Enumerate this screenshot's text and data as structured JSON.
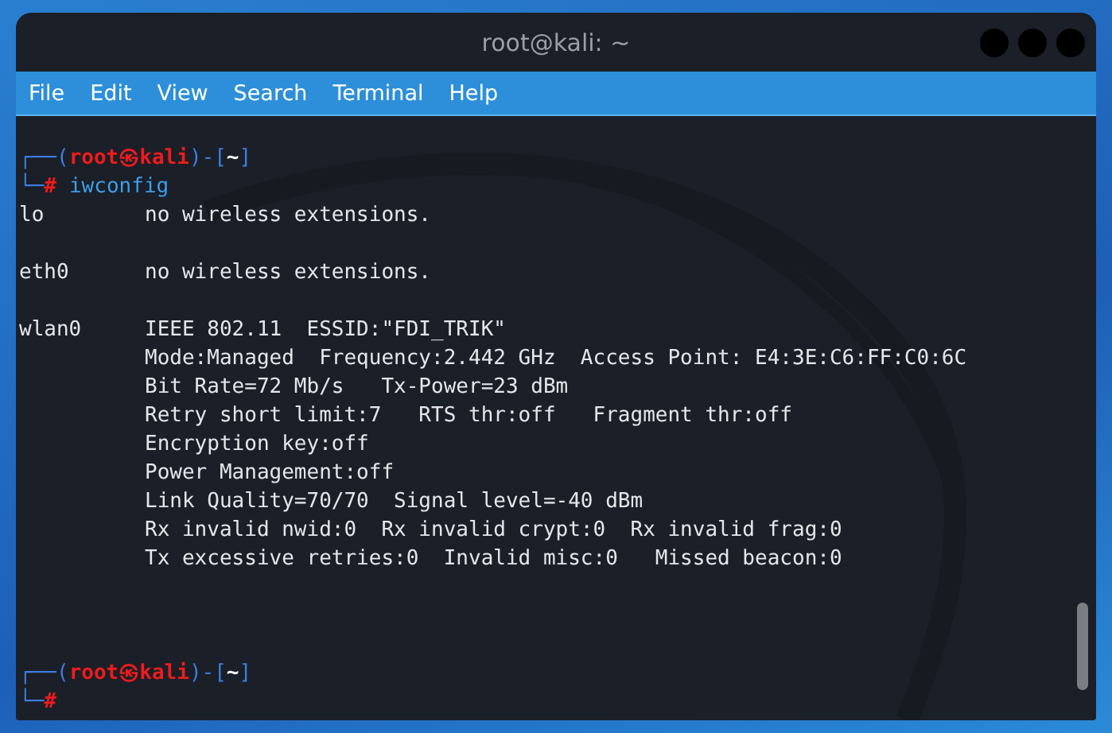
{
  "window": {
    "title": "root@kali: ~"
  },
  "menu": [
    "File",
    "Edit",
    "View",
    "Search",
    "Terminal",
    "Help"
  ],
  "sessions": [
    {
      "prompt": {
        "frame_top": "┌──(",
        "user": "root",
        "separator": "㉿",
        "host": "kali",
        "middle": ")-[",
        "dir": "~",
        "close": "]",
        "frame_bottom": "└─",
        "symbol": "#"
      },
      "command": "iwconfig",
      "output": [
        {
          "interface": "lo",
          "lines": [
            "no wireless extensions."
          ]
        },
        {
          "interface": "eth0",
          "lines": [
            "no wireless extensions."
          ]
        },
        {
          "interface": "wlan0",
          "lines": [
            "IEEE 802.11  ESSID:\"FDI_TRIK\"",
            "Mode:Managed  Frequency:2.442 GHz  Access Point: E4:3E:C6:FF:C0:6C",
            "Bit Rate=72 Mb/s   Tx-Power=23 dBm",
            "Retry short limit:7   RTS thr:off   Fragment thr:off",
            "Encryption key:off",
            "Power Management:off",
            "Link Quality=70/70  Signal level=-40 dBm",
            "Rx invalid nwid:0  Rx invalid crypt:0  Rx invalid frag:0",
            "Tx excessive retries:0  Invalid misc:0   Missed beacon:0"
          ]
        }
      ]
    },
    {
      "prompt": {
        "frame_top": "┌──(",
        "user": "root",
        "separator": "㉿",
        "host": "kali",
        "middle": ")-[",
        "dir": "~",
        "close": "]",
        "frame_bottom": "└─",
        "symbol": "#"
      }
    }
  ]
}
